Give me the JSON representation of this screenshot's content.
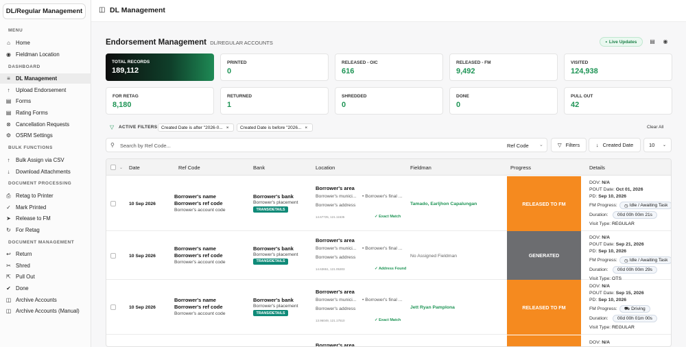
{
  "brand": "DL/Regular Management",
  "sidebar": {
    "sections": [
      "MENU",
      "DASHBOARD",
      "BULK FUNCTIONS",
      "DOCUMENT PROCESSING",
      "DOCUMENT MANAGEMENT"
    ],
    "items": [
      {
        "label": "Home",
        "icon": "home-icon"
      },
      {
        "label": "Fieldman Location",
        "icon": "map-pin-icon"
      },
      {
        "label": "DL Management",
        "icon": "list-icon"
      },
      {
        "label": "Upload Endorsement",
        "icon": "upload-icon"
      },
      {
        "label": "Forms",
        "icon": "file-icon"
      },
      {
        "label": "Rating Forms",
        "icon": "file-icon"
      },
      {
        "label": "Cancellation Requests",
        "icon": "circle-x-icon"
      },
      {
        "label": "OSRM Settings",
        "icon": "settings-icon"
      },
      {
        "label": "Bulk Assign via CSV",
        "icon": "upload-icon"
      },
      {
        "label": "Download Attachments",
        "icon": "download-icon"
      },
      {
        "label": "Retag to Printer",
        "icon": "printer-icon"
      },
      {
        "label": "Mark Printed",
        "icon": "check-icon"
      },
      {
        "label": "Release to FM",
        "icon": "send-icon"
      },
      {
        "label": "For Retag",
        "icon": "refresh-icon"
      },
      {
        "label": "Return",
        "icon": "return-icon"
      },
      {
        "label": "Shred",
        "icon": "shred-icon"
      },
      {
        "label": "Pull Out",
        "icon": "pullout-icon"
      },
      {
        "label": "Done",
        "icon": "check-circle-icon"
      },
      {
        "label": "Archive Accounts",
        "icon": "archive-icon"
      },
      {
        "label": "Archive Accounts (Manual)",
        "icon": "archive-icon"
      }
    ]
  },
  "topbar": {
    "title": "DL Management"
  },
  "header": {
    "title": "Endorsement Management",
    "subtitle": "DL/REGULAR ACCOUNTS",
    "live": "Live Updates"
  },
  "stats": [
    {
      "label": "TOTAL RECORDS",
      "value": "189,112"
    },
    {
      "label": "PRINTED",
      "value": "0"
    },
    {
      "label": "RELEASED - OIC",
      "value": "616"
    },
    {
      "label": "RELEASED - FM",
      "value": "9,492"
    },
    {
      "label": "VISITED",
      "value": "124,938"
    },
    {
      "label": "FOR RETAG",
      "value": "8,180"
    },
    {
      "label": "RETURNED",
      "value": "1"
    },
    {
      "label": "SHREDDED",
      "value": "0"
    },
    {
      "label": "DONE",
      "value": "0"
    },
    {
      "label": "PULL OUT",
      "value": "42"
    }
  ],
  "filters": {
    "label": "ACTIVE FILTERS",
    "chips": [
      "Created Date is after \"2026-0...",
      "Created Date is before \"2026..."
    ],
    "clear": "Clear All"
  },
  "search": {
    "placeholder": "Search by Ref Code...",
    "field": "Ref Code",
    "filters_btn": "Filters",
    "sort_btn": "Created Date",
    "page_size": "10"
  },
  "columns": [
    "Date",
    "Ref Code",
    "Bank",
    "Location",
    "Fieldman",
    "Progress",
    "Details"
  ],
  "rows": [
    {
      "date": "10 Sep 2026",
      "ref_name": "Borrower's name",
      "ref_code": "Borrower's ref code",
      "account": "Borrower's account code",
      "bank": "Borrower's bank",
      "placement": "Borrower's placement",
      "trans": "TRANS/DETAILS",
      "area": "Borrower's area",
      "muni": "Borrower's munici...",
      "final": "Borrower's final ...",
      "address": "Borrower's address",
      "coords": "14.67725, 121.11535",
      "loc_status": "Exact Match",
      "fieldman": "Tamado, Earljhon Capalungan",
      "progress": "RELEASED TO FM",
      "dov": "N/A",
      "pout": "Oct 01, 2026",
      "pd": "Sep 10, 2026",
      "fm_progress": "Idle / Awaiting Task",
      "duration": "00d 00h 00m 21s",
      "visit_type": "REGULAR"
    },
    {
      "date": "10 Sep 2026",
      "ref_name": "Borrower's name",
      "ref_code": "Borrower's ref code",
      "account": "Borrower's account code",
      "bank": "Borrower's bank",
      "placement": "Borrower's placement",
      "trans": "TRANS/DETAILS",
      "area": "Borrower's area",
      "muni": "Borrower's munici...",
      "final": "Borrower's final ...",
      "address": "Borrower's address",
      "coords": "14.63651, 121.05303",
      "loc_status": "Address Found",
      "fieldman": "No Assigned Fieldman",
      "progress": "GENERATED",
      "dov": "N/A",
      "pout": "Sep 21, 2026",
      "pd": "Sep 10, 2026",
      "fm_progress": "Idle / Awaiting Task",
      "duration": "00d 00h 00m 29s",
      "visit_type": "OTS"
    },
    {
      "date": "10 Sep 2026",
      "ref_name": "Borrower's name",
      "ref_code": "Borrower's ref code",
      "account": "Borrower's account code",
      "bank": "Borrower's bank",
      "placement": "Borrower's placement",
      "trans": "TRANS/DETAILS",
      "area": "Borrower's area",
      "muni": "Borrower's munici...",
      "final": "Borrower's final ...",
      "address": "Borrower's address",
      "coords": "13.96049, 121.17510",
      "loc_status": "Exact Match",
      "fieldman": "Jett Ryan Pamplona",
      "progress": "RELEASED TO FM",
      "dov": "N/A",
      "pout": "Sep 15, 2026",
      "pd": "Sep 10, 2026",
      "fm_progress": "Driving",
      "duration": "00d 00h 01m 00s",
      "visit_type": "REGULAR"
    },
    {
      "area": "Borrower's area",
      "dov": "N/A"
    }
  ],
  "details_labels": {
    "dov": "DOV:",
    "pout": "POUT Date:",
    "pd": "PD:",
    "fm": "FM Progress:",
    "duration": "Duration:",
    "visit": "Visit Type:"
  },
  "colors": {
    "accent": "#1e9455",
    "released": "#f58a1f",
    "generated": "#6c6d70",
    "trans": "#0f8a78"
  }
}
